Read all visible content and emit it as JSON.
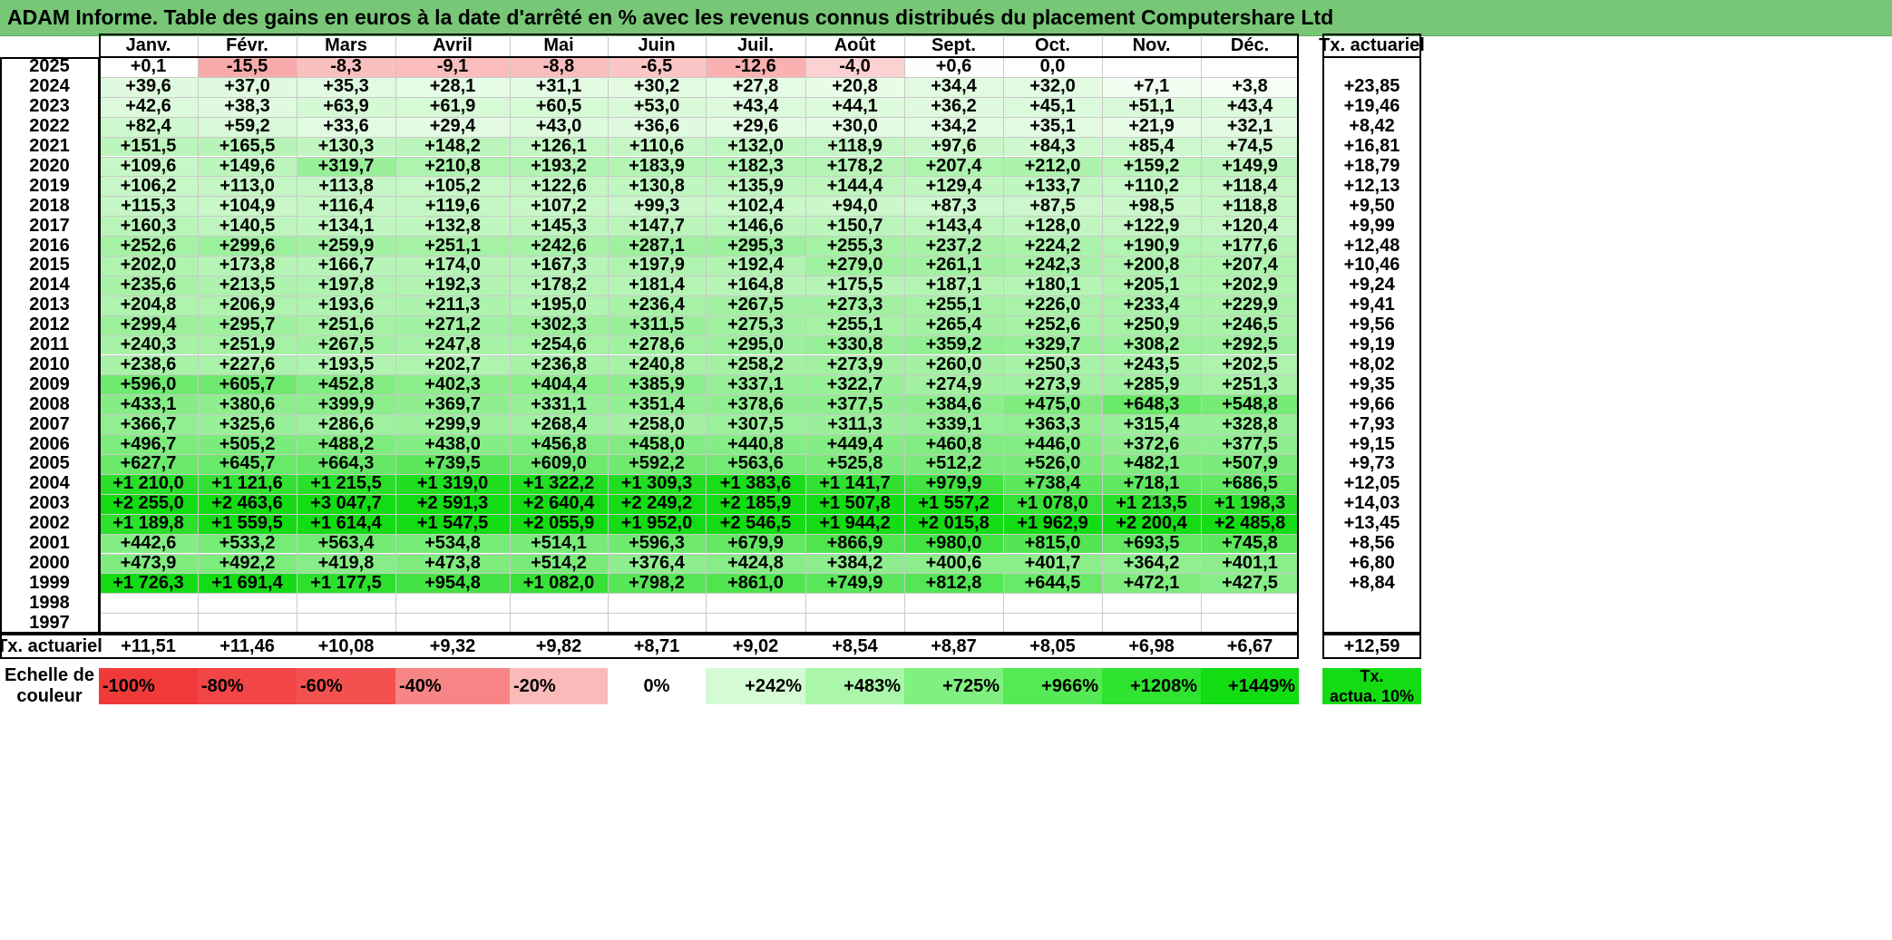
{
  "title": "ADAM Informe. Table des gains en euros à la date d'arrêté en % avec les revenus connus distribués du placement Computershare Ltd",
  "months": [
    "Janv.",
    "Févr.",
    "Mars",
    "Avril",
    "Mai",
    "Juin",
    "Juil.",
    "Août",
    "Sept.",
    "Oct.",
    "Nov.",
    "Déc."
  ],
  "rate_header": "Tx. actuariel",
  "rows": [
    {
      "year": "2025",
      "values": [
        "+0,1",
        "-15,5",
        "-8,3",
        "-9,1",
        "-8,8",
        "-6,5",
        "-12,6",
        "-4,0",
        "+0,6",
        "0,0",
        "",
        ""
      ],
      "rate": ""
    },
    {
      "year": "2024",
      "values": [
        "+39,6",
        "+37,0",
        "+35,3",
        "+28,1",
        "+31,1",
        "+30,2",
        "+27,8",
        "+20,8",
        "+34,4",
        "+32,0",
        "+7,1",
        "+3,8"
      ],
      "rate": "+23,85"
    },
    {
      "year": "2023",
      "values": [
        "+42,6",
        "+38,3",
        "+63,9",
        "+61,9",
        "+60,5",
        "+53,0",
        "+43,4",
        "+44,1",
        "+36,2",
        "+45,1",
        "+51,1",
        "+43,4"
      ],
      "rate": "+19,46"
    },
    {
      "year": "2022",
      "values": [
        "+82,4",
        "+59,2",
        "+33,6",
        "+29,4",
        "+43,0",
        "+36,6",
        "+29,6",
        "+30,0",
        "+34,2",
        "+35,1",
        "+21,9",
        "+32,1"
      ],
      "rate": "+8,42"
    },
    {
      "year": "2021",
      "values": [
        "+151,5",
        "+165,5",
        "+130,3",
        "+148,2",
        "+126,1",
        "+110,6",
        "+132,0",
        "+118,9",
        "+97,6",
        "+84,3",
        "+85,4",
        "+74,5"
      ],
      "rate": "+16,81"
    },
    {
      "year": "2020",
      "values": [
        "+109,6",
        "+149,6",
        "+319,7",
        "+210,8",
        "+193,2",
        "+183,9",
        "+182,3",
        "+178,2",
        "+207,4",
        "+212,0",
        "+159,2",
        "+149,9"
      ],
      "rate": "+18,79"
    },
    {
      "year": "2019",
      "values": [
        "+106,2",
        "+113,0",
        "+113,8",
        "+105,2",
        "+122,6",
        "+130,8",
        "+135,9",
        "+144,4",
        "+129,4",
        "+133,7",
        "+110,2",
        "+118,4"
      ],
      "rate": "+12,13"
    },
    {
      "year": "2018",
      "values": [
        "+115,3",
        "+104,9",
        "+116,4",
        "+119,6",
        "+107,2",
        "+99,3",
        "+102,4",
        "+94,0",
        "+87,3",
        "+87,5",
        "+98,5",
        "+118,8"
      ],
      "rate": "+9,50"
    },
    {
      "year": "2017",
      "values": [
        "+160,3",
        "+140,5",
        "+134,1",
        "+132,8",
        "+145,3",
        "+147,7",
        "+146,6",
        "+150,7",
        "+143,4",
        "+128,0",
        "+122,9",
        "+120,4"
      ],
      "rate": "+9,99"
    },
    {
      "year": "2016",
      "values": [
        "+252,6",
        "+299,6",
        "+259,9",
        "+251,1",
        "+242,6",
        "+287,1",
        "+295,3",
        "+255,3",
        "+237,2",
        "+224,2",
        "+190,9",
        "+177,6"
      ],
      "rate": "+12,48"
    },
    {
      "year": "2015",
      "values": [
        "+202,0",
        "+173,8",
        "+166,7",
        "+174,0",
        "+167,3",
        "+197,9",
        "+192,4",
        "+279,0",
        "+261,1",
        "+242,3",
        "+200,8",
        "+207,4"
      ],
      "rate": "+10,46"
    },
    {
      "year": "2014",
      "values": [
        "+235,6",
        "+213,5",
        "+197,8",
        "+192,3",
        "+178,2",
        "+181,4",
        "+164,8",
        "+175,5",
        "+187,1",
        "+180,1",
        "+205,1",
        "+202,9"
      ],
      "rate": "+9,24"
    },
    {
      "year": "2013",
      "values": [
        "+204,8",
        "+206,9",
        "+193,6",
        "+211,3",
        "+195,0",
        "+236,4",
        "+267,5",
        "+273,3",
        "+255,1",
        "+226,0",
        "+233,4",
        "+229,9"
      ],
      "rate": "+9,41"
    },
    {
      "year": "2012",
      "values": [
        "+299,4",
        "+295,7",
        "+251,6",
        "+271,2",
        "+302,3",
        "+311,5",
        "+275,3",
        "+255,1",
        "+265,4",
        "+252,6",
        "+250,9",
        "+246,5"
      ],
      "rate": "+9,56"
    },
    {
      "year": "2011",
      "values": [
        "+240,3",
        "+251,9",
        "+267,5",
        "+247,8",
        "+254,6",
        "+278,6",
        "+295,0",
        "+330,8",
        "+359,2",
        "+329,7",
        "+308,2",
        "+292,5"
      ],
      "rate": "+9,19"
    },
    {
      "year": "2010",
      "values": [
        "+238,6",
        "+227,6",
        "+193,5",
        "+202,7",
        "+236,8",
        "+240,8",
        "+258,2",
        "+273,9",
        "+260,0",
        "+250,3",
        "+243,5",
        "+202,5"
      ],
      "rate": "+8,02"
    },
    {
      "year": "2009",
      "values": [
        "+596,0",
        "+605,7",
        "+452,8",
        "+402,3",
        "+404,4",
        "+385,9",
        "+337,1",
        "+322,7",
        "+274,9",
        "+273,9",
        "+285,9",
        "+251,3"
      ],
      "rate": "+9,35"
    },
    {
      "year": "2008",
      "values": [
        "+433,1",
        "+380,6",
        "+399,9",
        "+369,7",
        "+331,1",
        "+351,4",
        "+378,6",
        "+377,5",
        "+384,6",
        "+475,0",
        "+648,3",
        "+548,8"
      ],
      "rate": "+9,66"
    },
    {
      "year": "2007",
      "values": [
        "+366,7",
        "+325,6",
        "+286,6",
        "+299,9",
        "+268,4",
        "+258,0",
        "+307,5",
        "+311,3",
        "+339,1",
        "+363,3",
        "+315,4",
        "+328,8"
      ],
      "rate": "+7,93"
    },
    {
      "year": "2006",
      "values": [
        "+496,7",
        "+505,2",
        "+488,2",
        "+438,0",
        "+456,8",
        "+458,0",
        "+440,8",
        "+449,4",
        "+460,8",
        "+446,0",
        "+372,6",
        "+377,5"
      ],
      "rate": "+9,15"
    },
    {
      "year": "2005",
      "values": [
        "+627,7",
        "+645,7",
        "+664,3",
        "+739,5",
        "+609,0",
        "+592,2",
        "+563,6",
        "+525,8",
        "+512,2",
        "+526,0",
        "+482,1",
        "+507,9"
      ],
      "rate": "+9,73"
    },
    {
      "year": "2004",
      "values": [
        "+1 210,0",
        "+1 121,6",
        "+1 215,5",
        "+1 319,0",
        "+1 322,2",
        "+1 309,3",
        "+1 383,6",
        "+1 141,7",
        "+979,9",
        "+738,4",
        "+718,1",
        "+686,5"
      ],
      "rate": "+12,05"
    },
    {
      "year": "2003",
      "values": [
        "+2 255,0",
        "+2 463,6",
        "+3 047,7",
        "+2 591,3",
        "+2 640,4",
        "+2 249,2",
        "+2 185,9",
        "+1 507,8",
        "+1 557,2",
        "+1 078,0",
        "+1 213,5",
        "+1 198,3"
      ],
      "rate": "+14,03"
    },
    {
      "year": "2002",
      "values": [
        "+1 189,8",
        "+1 559,5",
        "+1 614,4",
        "+1 547,5",
        "+2 055,9",
        "+1 952,0",
        "+2 546,5",
        "+1 944,2",
        "+2 015,8",
        "+1 962,9",
        "+2 200,4",
        "+2 485,8"
      ],
      "rate": "+13,45"
    },
    {
      "year": "2001",
      "values": [
        "+442,6",
        "+533,2",
        "+563,4",
        "+534,8",
        "+514,1",
        "+596,3",
        "+679,9",
        "+866,9",
        "+980,0",
        "+815,0",
        "+693,5",
        "+745,8"
      ],
      "rate": "+8,56"
    },
    {
      "year": "2000",
      "values": [
        "+473,9",
        "+492,2",
        "+419,8",
        "+473,8",
        "+514,2",
        "+376,4",
        "+424,8",
        "+384,2",
        "+400,6",
        "+401,7",
        "+364,2",
        "+401,1"
      ],
      "rate": "+6,80"
    },
    {
      "year": "1999",
      "values": [
        "+1 726,3",
        "+1 691,4",
        "+1 177,5",
        "+954,8",
        "+1 082,0",
        "+798,2",
        "+861,0",
        "+749,9",
        "+812,8",
        "+644,5",
        "+472,1",
        "+427,5"
      ],
      "rate": "+8,84"
    },
    {
      "year": "1998",
      "values": [
        "",
        "",
        "",
        "",
        "",
        "",
        "",
        "",
        "",
        "",
        "",
        ""
      ],
      "rate": ""
    },
    {
      "year": "1997",
      "values": [
        "",
        "",
        "",
        "",
        "",
        "",
        "",
        "",
        "",
        "",
        "",
        ""
      ],
      "rate": ""
    }
  ],
  "footer": {
    "label": "Tx. actuariel",
    "values": [
      "+11,51",
      "+11,46",
      "+10,08",
      "+9,32",
      "+9,82",
      "+8,71",
      "+9,02",
      "+8,54",
      "+8,87",
      "+8,05",
      "+6,98",
      "+6,67"
    ],
    "rate": "+12,59"
  },
  "legend": {
    "label_line1": "Echelle de",
    "label_line2": "couleur",
    "items": [
      {
        "text": "-100%",
        "color": "#f03a3a",
        "align": "left"
      },
      {
        "text": "-80%",
        "color": "#f24545",
        "align": "left"
      },
      {
        "text": "-60%",
        "color": "#f55050",
        "align": "left"
      },
      {
        "text": "-40%",
        "color": "#f88585",
        "align": "left"
      },
      {
        "text": "-20%",
        "color": "#fbbaba",
        "align": "left"
      },
      {
        "text": "0%",
        "color": "#ffffff",
        "align": "center"
      },
      {
        "text": "+242%",
        "color": "#d4fbd4",
        "align": "right"
      },
      {
        "text": "+483%",
        "color": "#aaf6aa",
        "align": "right"
      },
      {
        "text": "+725%",
        "color": "#80f080",
        "align": "right"
      },
      {
        "text": "+966%",
        "color": "#55ea55",
        "align": "right"
      },
      {
        "text": "+1208%",
        "color": "#2ee42e",
        "align": "right"
      },
      {
        "text": "+1449%",
        "color": "#12dc12",
        "align": "right"
      }
    ],
    "rate_line1": "Tx.",
    "rate_line2": "actua. 10%",
    "rate_color": "#14dc14"
  }
}
